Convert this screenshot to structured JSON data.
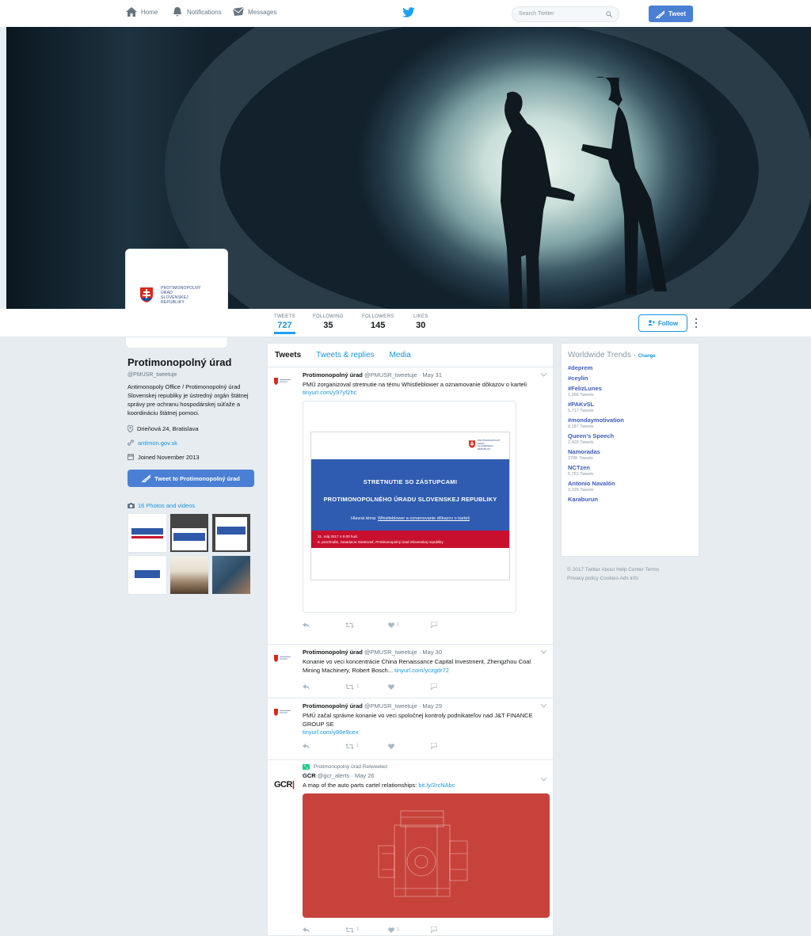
{
  "nav": {
    "home": "Home",
    "notifications": "Notifications",
    "messages": "Messages",
    "search_placeholder": "Search Twitter",
    "tweet_button": "Tweet"
  },
  "profile": {
    "avatar_logo_text_1": "PROTIMONOPOLNÝ",
    "avatar_logo_text_2": "ÚRAD",
    "avatar_logo_text_3": "SLOVENSKEJ",
    "avatar_logo_text_4": "REPUBLIKY",
    "name": "Protimonopolný úrad",
    "handle": "@PMUSR_tweetuje",
    "bio": "Antimonopoly Office / Protimonopolný úrad Slovenskej republiky je ústredný orgán štátnej správy pre ochranu hospodárskej súťaže a koordináciu štátnej pomoci.",
    "location": "Drieňová 24, Bratislava",
    "website": "antimon.gov.sk",
    "joined": "Joined November 2013",
    "tweet_to_button": "Tweet to Protimonopolný úrad",
    "photos_link": "16 Photos and videos"
  },
  "stats": [
    {
      "label": "TWEETS",
      "value": "727"
    },
    {
      "label": "FOLLOWING",
      "value": "35"
    },
    {
      "label": "FOLLOWERS",
      "value": "145"
    },
    {
      "label": "LIKES",
      "value": "30"
    }
  ],
  "follow_button": "Follow",
  "timeline": {
    "tabs": [
      "Tweets",
      "Tweets & replies",
      "Media"
    ],
    "tweets": [
      {
        "name": "Protimonopolný úrad",
        "handle": "@PMUSR_tweetuje",
        "date": "May 31",
        "text": "PMÚ zorganizoval stretnutie na tému Whistleblower a oznamovanie dôkazov o karteli",
        "link": "tinyurl.com/y97yf2hc",
        "slide": {
          "line1": "STRETNUTIE SO ZÁSTUPCAMI",
          "line2": "PROTIMONOPOLNÉHO ÚRADU SLOVENSKEJ REPUBLIKY",
          "topic_label": "Hlavná téma:",
          "topic": "Whistleblower a oznamovanie dôkazov o karteli",
          "date_line": "31. máj 2017 o 9.00 hod.",
          "place_line": "8. poschodie, zasadacia miestnosť, Protimonopolný úrad Slovenskej republiky"
        },
        "retweets": "",
        "likes": "1"
      },
      {
        "name": "Protimonopolný úrad",
        "handle": "@PMUSR_tweetuje",
        "date": "May 30",
        "text": "Konanie vo veci koncentrácie China Renaissance Capital Investment, Zhengzhou Coal Mining Machinery, Robert Bosch...",
        "link": "tinyurl.com/yczgdr72",
        "retweets": "1",
        "likes": ""
      },
      {
        "name": "Protimonopolný úrad",
        "handle": "@PMUSR_tweetuje",
        "date": "May 29",
        "text": "PMÚ začal správne konanie vo veci spoločnej kontroly podnikateľov nad J&T FINANCE GROUP SE",
        "link": "tinyurl.com/y86e9cex",
        "retweets": "1",
        "likes": ""
      },
      {
        "retweeted_by": "Protimonopolný úrad Retweeted",
        "name": "GCR",
        "handle": "@gcr_alerts",
        "date": "May 26",
        "text": "A map of the auto parts cartel relationships:",
        "link": "bit.ly/2rcNAbc",
        "avatar_text": "GCR",
        "retweets": "1",
        "likes": "1"
      }
    ]
  },
  "trends": {
    "title": "Worldwide Trends",
    "change": "Change",
    "items": [
      {
        "name": "#deprem",
        "count": ""
      },
      {
        "name": "#ceylin",
        "count": ""
      },
      {
        "name": "#FelizLunes",
        "count": "1,386 Tweets"
      },
      {
        "name": "#PAKvSL",
        "count": "5,717 Tweets"
      },
      {
        "name": "#mondaymotivation",
        "count": "8,187 Tweets"
      },
      {
        "name": "Queen's Speech",
        "count": "2,429 Tweets"
      },
      {
        "name": "Namoradas",
        "count": "370K Tweets"
      },
      {
        "name": "NCTzen",
        "count": "5,751 Tweets"
      },
      {
        "name": "Antonio Navalón",
        "count": "3,339 Tweets"
      },
      {
        "name": "Karaburun",
        "count": ""
      }
    ]
  },
  "footer": {
    "line1": "© 2017 Twitter  About  Help Center  Terms",
    "line2": "Privacy policy  Cookies  Ads info"
  },
  "colors": {
    "accent": "#1b95e0",
    "button": "#4a7fd4",
    "trend": "#3b5bbf",
    "slide_blue": "#2f5cb0",
    "slide_red": "#c8102e",
    "red_card": "#c7423b"
  }
}
